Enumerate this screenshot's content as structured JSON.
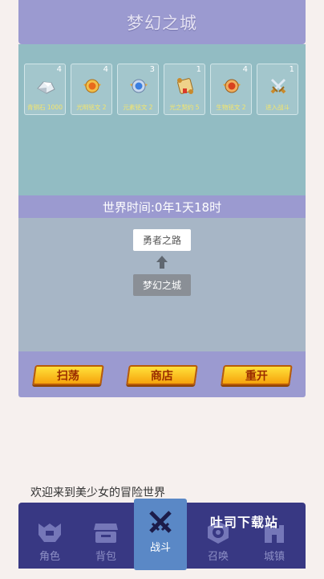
{
  "header": {
    "title": "梦幻之城"
  },
  "items": [
    {
      "label": "青铜石 1000",
      "count": "4",
      "icon": "silver-ore-icon"
    },
    {
      "label": "光明铭文 2",
      "count": "4",
      "icon": "light-medal-icon"
    },
    {
      "label": "元素铭文 2",
      "count": "3",
      "icon": "element-medal-icon"
    },
    {
      "label": "光之契约 5",
      "count": "1",
      "icon": "scroll-icon"
    },
    {
      "label": "生物铭文 2",
      "count": "4",
      "icon": "creature-medal-icon"
    },
    {
      "label": "进入战斗",
      "count": "1",
      "icon": "crossed-swords-icon"
    }
  ],
  "world_time": "世界时间:0年1天18时",
  "map": {
    "next_node": "勇者之路",
    "current_node": "梦幻之城"
  },
  "actions": {
    "sweep": "扫荡",
    "shop": "商店",
    "restart": "重开"
  },
  "welcome": "欢迎来到美少女的冒险世界",
  "nav": {
    "role": "角色",
    "bag": "背包",
    "battle": "战斗",
    "summon": "召唤",
    "town": "城镇"
  },
  "watermark": "吐司下载站",
  "colors": {
    "panel": "#9b9ad0",
    "items_bg": "#92bcc3",
    "map_bg": "#a7b6c6",
    "nav_bg": "#383883",
    "nav_active": "#5a88c6",
    "button": "#f6a30c"
  }
}
